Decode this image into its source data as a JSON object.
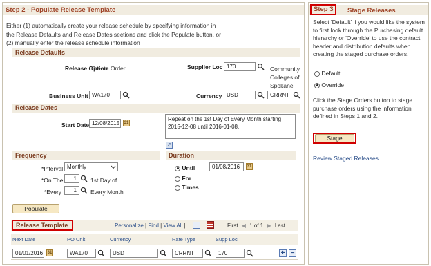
{
  "step2": {
    "title": "Step 2 - Populate Release Template",
    "instructions": [
      "Either (1) automatically create your release schedule by specifying information in",
      "the Release Defaults and Release Dates sections and click the Populate button, or",
      "(2) manually enter the release schedule information"
    ]
  },
  "release_defaults": {
    "header": "Release Defaults",
    "release_option_label": "Release Option",
    "release_option_value": "Create Order",
    "supplier_loc_label": "Supplier Loc",
    "supplier_loc_value": "170",
    "supplier_name_lines": [
      "Community",
      "Colleges of",
      "Spokane"
    ],
    "business_unit_label": "Business Unit",
    "business_unit_value": "WA170",
    "currency_label": "Currency",
    "currency_value": "USD",
    "rate_value": "CRRNT"
  },
  "release_dates": {
    "header": "Release Dates",
    "start_date_label": "Start Date",
    "start_date_value": "12/08/2015",
    "repeat_text_lines": [
      "Repeat on the 1st Day of Every Month starting",
      "2015-12-08 until 2016-01-08."
    ]
  },
  "frequency": {
    "header": "Frequency",
    "interval_label": "*Interval",
    "interval_value": "Monthly",
    "on_the_label": "*On The",
    "on_the_value": "1",
    "on_the_suffix": "1st Day of",
    "every_label": "*Every",
    "every_value": "1",
    "every_suffix": "Every Month"
  },
  "duration": {
    "header": "Duration",
    "options": [
      "Until",
      "For",
      "Times"
    ],
    "selected": "Until",
    "until_date": "01/08/2016"
  },
  "populate_label": "Populate",
  "release_template": {
    "header": "Release Template",
    "nav": {
      "personalize": "Personalize",
      "find": "Find",
      "view_all": "View All",
      "first": "First",
      "range": "1 of 1",
      "last": "Last"
    },
    "columns": [
      "Next Date",
      "PO Unit",
      "Currency",
      "Rate Type",
      "Supp Loc"
    ],
    "rows": [
      {
        "next_date": "01/01/2016",
        "po_unit": "WA170",
        "currency": "USD",
        "rate_type": "CRRNT",
        "supp_loc": "170"
      }
    ]
  },
  "step3": {
    "tag": "Step 3",
    "title": "Stage Releases",
    "text_lines": [
      "Select 'Default' if you would like the system",
      "to first look through the Purchasing default",
      "hierarchy or 'Override' to use the contract",
      "header and distribution defaults when",
      "creating the staged purchase orders."
    ],
    "options": [
      "Default",
      "Override"
    ],
    "selected": "Override",
    "text2_lines": [
      "Click the Stage Orders button to stage",
      "purchase orders using the information",
      "defined in Steps 1 and 2."
    ],
    "stage_label": "Stage",
    "review_link": "Review Staged Releases"
  }
}
